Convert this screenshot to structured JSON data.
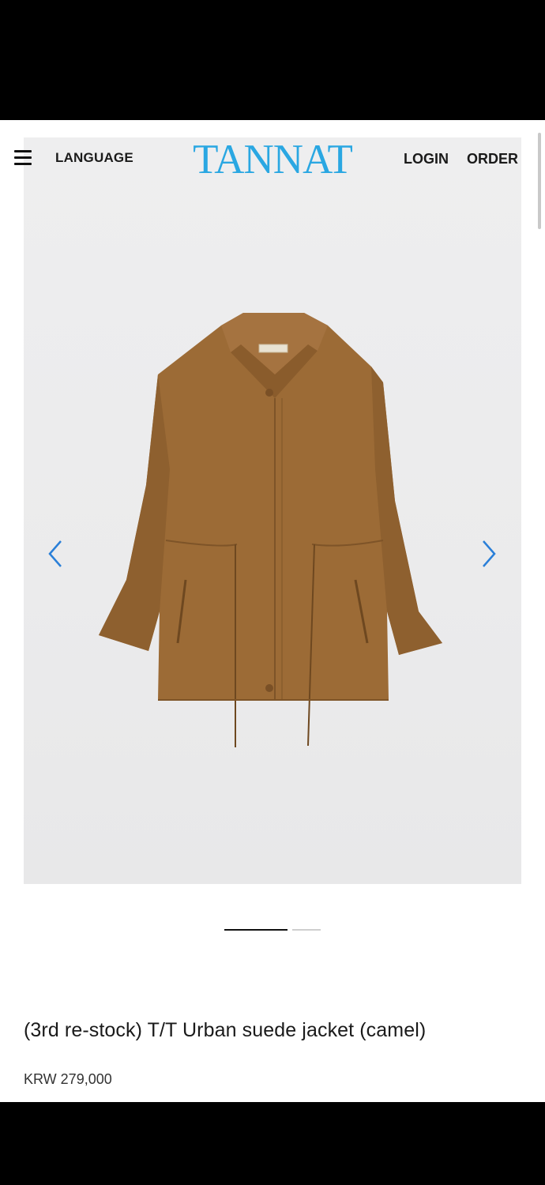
{
  "header": {
    "language_label": "LANGUAGE",
    "logo_text": "TANNAT",
    "login_label": "LOGIN",
    "order_label": "ORDER",
    "menu_icon": "hamburger-menu-icon"
  },
  "gallery": {
    "prev_icon": "chevron-left-icon",
    "next_icon": "chevron-right-icon",
    "slide_count": 2,
    "active_slide": 1,
    "arrow_color": "#2a7fd8"
  },
  "product": {
    "name": "(3rd re-stock) T/T Urban suede jacket (camel)",
    "price": "KRW 279,000"
  },
  "colors": {
    "logo": "#2aa7e2",
    "jacket": "#9c6b36"
  }
}
